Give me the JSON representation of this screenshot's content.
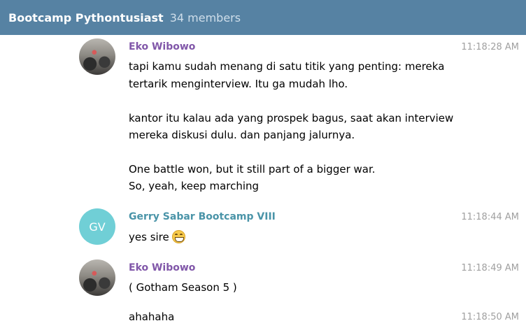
{
  "header": {
    "title": "Bootcamp Pythontusiast",
    "members": "34 members"
  },
  "messages": [
    {
      "author": "Eko Wibowo",
      "time": "11:18:28 AM",
      "lines": [
        "tapi kamu sudah menang di satu titik yang penting: mereka",
        "tertarik menginterview. Itu ga mudah lho.",
        "kantor itu kalau ada yang prospek bagus, saat akan interview",
        "mereka diskusi dulu. dan panjang jalurnya.",
        "One battle won, but it still part of a bigger war.",
        "So, yeah, keep marching"
      ]
    },
    {
      "author": "Gerry Sabar Bootcamp VIII",
      "avatar_initials": "GV",
      "time": "11:18:44 AM",
      "text": "yes sire",
      "emoji": "grinning-face"
    },
    {
      "author": "Eko Wibowo",
      "time": "11:18:49 AM",
      "text": "( Gotham Season 5 )"
    },
    {
      "time": "11:18:50 AM",
      "text": "ahahaha"
    }
  ],
  "colors": {
    "header_bg": "#5682a3",
    "author_eko": "#8157a9",
    "author_gerry": "#4a94a8",
    "avatar_gv": "#70cfd6",
    "timestamp": "#a0a0a0"
  }
}
